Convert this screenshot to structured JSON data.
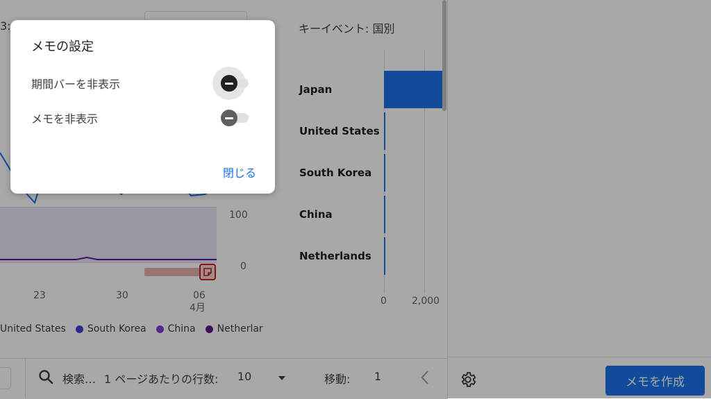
{
  "chart": {
    "partial_header_label": "3: [",
    "y_ticks": [
      "100",
      "0"
    ],
    "x_ticks": [
      "23",
      "30",
      "06"
    ],
    "x_sub_tick": "4月",
    "legend": [
      {
        "label": "United States",
        "color": "#1a73e8"
      },
      {
        "label": "South Korea",
        "color": "#3f3fd6"
      },
      {
        "label": "China",
        "color": "#7e3fd6"
      },
      {
        "label": "Netherlar",
        "color": "#5b1a8c"
      }
    ]
  },
  "bar_chart": {
    "title": "キーイベント: 国別",
    "countries": [
      "Japan",
      "United States",
      "South Korea",
      "China",
      "Netherlands"
    ],
    "x_ticks": [
      "0",
      "2,000"
    ]
  },
  "chart_data": {
    "type": "bar",
    "title": "キーイベント: 国別",
    "categories": [
      "Japan",
      "United States",
      "South Korea",
      "China",
      "Netherlands"
    ],
    "values": [
      2500,
      15,
      10,
      8,
      6
    ],
    "xlabel": "",
    "ylabel": "",
    "xlim": [
      0,
      2500
    ],
    "orientation": "horizontal",
    "grid": true
  },
  "footer": {
    "search_label": "検索…",
    "rows_label": "1 ページあたりの行数:",
    "rows_value": "10",
    "goto_label": "移動:",
    "goto_value": "1"
  },
  "side": {
    "create_memo_label": "メモを作成"
  },
  "dialog": {
    "title": "メモの設定",
    "hide_period_bar_label": "期間バーを非表示",
    "hide_memo_label": "メモを非表示",
    "close_label": "閉じる",
    "hide_period_bar_on": false,
    "hide_memo_on": false
  },
  "colors": {
    "accent": "#1a73e8",
    "memo_marker": "#c5221f"
  }
}
